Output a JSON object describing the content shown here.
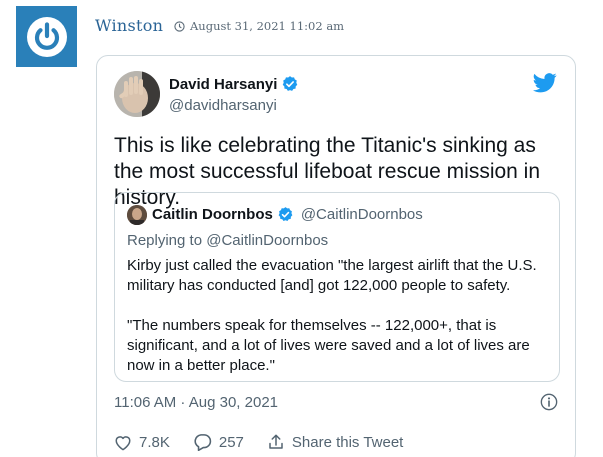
{
  "comment": {
    "author": "Winston",
    "date": "August 31, 2021 11:02 am"
  },
  "tweet": {
    "author_name": "David Harsanyi",
    "author_handle": "@davidharsanyi",
    "text": "This is like celebrating the Titanic's sinking as the most successful lifeboat rescue mission in history.",
    "time": "11:06 AM · Aug 30, 2021",
    "likes": "7.8K",
    "replies": "257",
    "share_label": "Share this Tweet",
    "quoted": {
      "author_name": "Caitlin Doornbos",
      "author_handle": "@CaitlinDoornbos",
      "replying_to": "Replying to @CaitlinDoornbos",
      "paragraph1": "Kirby just called the evacuation \"the largest airlift that the U.S. military has conducted [and] got 122,000 people to safety.",
      "paragraph2": "\"The numbers speak for themselves -- 122,000+, that is significant, and a lot of lives were saved and a lot of lives are now in a better place.\""
    }
  },
  "colors": {
    "avatar_bg": "#2a80b9",
    "author_link": "#2a6496",
    "twitter_blue": "#1d9bf0",
    "muted_text": "#536471",
    "border": "#cfd9de"
  },
  "icons": {
    "avatar": "power-icon",
    "clock": "clock-icon",
    "verified": "verified-badge-icon",
    "brand": "twitter-bird-icon",
    "info": "info-icon",
    "like": "heart-icon",
    "reply": "reply-bubble-icon",
    "share": "share-icon"
  }
}
